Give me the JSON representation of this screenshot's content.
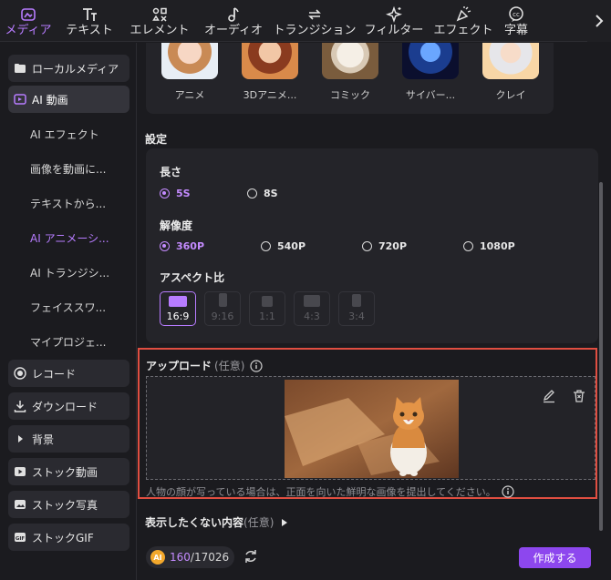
{
  "toolbar": {
    "tabs": [
      {
        "label": "メディア",
        "icon": "media-icon",
        "active": true
      },
      {
        "label": "テキスト",
        "icon": "text-icon",
        "active": false
      },
      {
        "label": "エレメント",
        "icon": "elements-icon",
        "active": false
      },
      {
        "label": "オーディオ",
        "icon": "audio-icon",
        "active": false
      },
      {
        "label": "トランジション",
        "icon": "transition-icon",
        "active": false
      },
      {
        "label": "フィルター",
        "icon": "filter-icon",
        "active": false
      },
      {
        "label": "エフェクト",
        "icon": "effect-icon",
        "active": false
      },
      {
        "label": "字幕",
        "icon": "caption-icon",
        "active": false
      }
    ]
  },
  "sidebar": {
    "local_media": "ローカルメディア",
    "ai_video": "AI 動画",
    "sub_items": [
      "AI エフェクト",
      "画像を動画に...",
      "テキストから...",
      "AI アニメーシ...",
      "AI トランジシ...",
      "フェイススワ...",
      "マイプロジェ..."
    ],
    "record": "レコード",
    "download": "ダウンロード",
    "background": "背景",
    "stock_video": "ストック動画",
    "stock_photo": "ストック写真",
    "stock_gif": "ストックGIF"
  },
  "styles": [
    "アニメ",
    "3Dアニメ...",
    "コミック",
    "サイバー...",
    "クレイ"
  ],
  "settings": {
    "title": "設定",
    "length_label": "長さ",
    "length_options": [
      "5S",
      "8S"
    ],
    "length_selected": "5S",
    "resolution_label": "解像度",
    "resolution_options": [
      "360P",
      "540P",
      "720P",
      "1080P"
    ],
    "resolution_selected": "360P",
    "aspect_label": "アスペクト比",
    "aspect_options": [
      "16:9",
      "9:16",
      "1:1",
      "4:3",
      "3:4"
    ],
    "aspect_selected": "16:9"
  },
  "upload": {
    "title": "アップロード",
    "optional": "(任意)",
    "hint": "人物の顔が写っている場合は、正面を向いた鮮明な画像を提出してください。"
  },
  "hidden_content": {
    "label": "表示したくない内容",
    "optional": "(任意)"
  },
  "footer": {
    "credits_used": "160",
    "credits_total": "/17026",
    "coin_label": "AI",
    "create_label": "作成する"
  },
  "colors": {
    "accent": "#b77cff",
    "button": "#8d47ee",
    "highlight_border": "#e04e41"
  }
}
